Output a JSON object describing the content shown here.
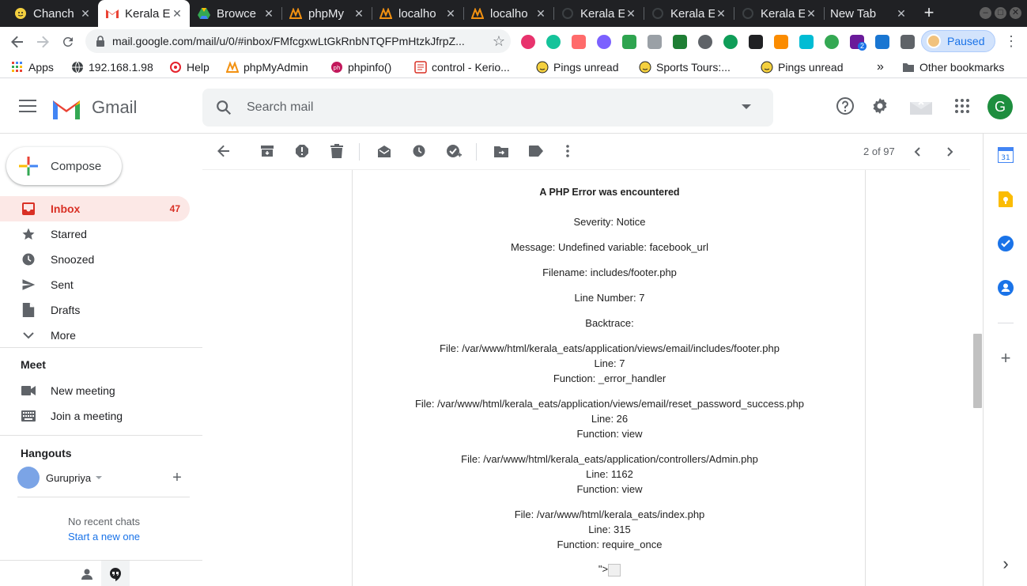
{
  "browser": {
    "tabs": [
      {
        "label": "Chanch",
        "close": "✕",
        "icon": "smiley-icon",
        "color": "#f4d03f"
      },
      {
        "label": "Kerala E",
        "close": "✕",
        "icon": "gmail-icon",
        "color": "#ea4335"
      },
      {
        "label": "Browce",
        "close": "✕",
        "icon": "google-drive-icon",
        "color": "#34a853"
      },
      {
        "label": "phpMy",
        "close": "✕",
        "icon": "phpmyadmin-icon",
        "color": "#f29111"
      },
      {
        "label": "localho",
        "close": "✕",
        "icon": "phpmyadmin-icon",
        "color": "#f29111"
      },
      {
        "label": "localho",
        "close": "✕",
        "icon": "phpmyadmin-icon",
        "color": "#f29111"
      },
      {
        "label": "Kerala E",
        "close": "✕",
        "icon": "loading-icon",
        "color": "#5f6368"
      },
      {
        "label": "Kerala E",
        "close": "✕",
        "icon": "loading-icon",
        "color": "#5f6368"
      },
      {
        "label": "Kerala E",
        "close": "✕",
        "icon": "loading-icon",
        "color": "#5f6368"
      },
      {
        "label": "New Tab",
        "close": "✕",
        "icon": "",
        "color": ""
      }
    ],
    "new_tab": "+",
    "window_controls": {
      "minimize": "–",
      "maximize": "□",
      "close": "✕"
    },
    "url": "mail.google.com/mail/u/0/#inbox/FMfcgxwLtGkRnbNTQFPmHtzkJfrpZ...",
    "star": "☆",
    "profile_status": "Paused",
    "menu": "⋮",
    "extensions": [
      "#e8336d",
      "#15c39a",
      "#ff6b6b",
      "#7b61ff",
      "#2ea44f",
      "#5f6368",
      "#1e7e34",
      "#5f6368",
      "#0f9d58",
      "#202124",
      "#fb8c00",
      "#00bcd4",
      "#34a853",
      "#6a1b9a",
      "#1976d2",
      "#5f6368"
    ],
    "extension_badge": "2",
    "bookmarks": [
      {
        "label": "Apps",
        "icon": "apps-grid-icon"
      },
      {
        "label": "192.168.1.98",
        "icon": "globe-icon"
      },
      {
        "label": "Help",
        "icon": "help-swirl-icon"
      },
      {
        "label": "phpMyAdmin",
        "icon": "phpmyadmin-icon"
      },
      {
        "label": "phpinfo()",
        "icon": "php-icon"
      },
      {
        "label": "control - Kerio...",
        "icon": "kerio-icon"
      },
      {
        "label": "Pings unread",
        "icon": "smiley-icon"
      },
      {
        "label": "Sports Tours:...",
        "icon": "smiley-icon"
      },
      {
        "label": "Pings unread",
        "icon": "smiley-icon"
      }
    ],
    "bookmarks_overflow": "»",
    "other_bookmarks": "Other bookmarks"
  },
  "gmail": {
    "logo_text": "Gmail",
    "search_placeholder": "Search mail",
    "avatar_letter": "G",
    "compose": "Compose",
    "nav": [
      {
        "label": "Inbox",
        "count": "47",
        "icon": "inbox-icon"
      },
      {
        "label": "Starred",
        "count": "",
        "icon": "star-icon"
      },
      {
        "label": "Snoozed",
        "count": "",
        "icon": "clock-icon"
      },
      {
        "label": "Sent",
        "count": "",
        "icon": "send-icon"
      },
      {
        "label": "Drafts",
        "count": "",
        "icon": "draft-icon"
      },
      {
        "label": "More",
        "count": "",
        "icon": "chevron-down-icon"
      }
    ],
    "meet": {
      "title": "Meet",
      "new_meeting": "New meeting",
      "join_meeting": "Join a meeting"
    },
    "hangouts": {
      "title": "Hangouts",
      "user": "Gurupriya",
      "no_chats": "No recent chats",
      "start_new": "Start a new one"
    },
    "pager": "2 of 97"
  },
  "email": {
    "title": "A PHP Error was encountered",
    "severity": "Severity: Notice",
    "message": "Message: Undefined variable: facebook_url",
    "filename": "Filename: includes/footer.php",
    "line_number": "Line Number: 7",
    "backtrace": "Backtrace:",
    "frames": [
      {
        "file": "File: /var/www/html/kerala_eats/application/views/email/includes/footer.php",
        "line": "Line: 7",
        "function": "Function: _error_handler"
      },
      {
        "file": "File: /var/www/html/kerala_eats/application/views/email/reset_password_success.php",
        "line": "Line: 26",
        "function": "Function: view"
      },
      {
        "file": "File: /var/www/html/kerala_eats/application/controllers/Admin.php",
        "line": "Line: 1162",
        "function": "Function: view"
      },
      {
        "file": "File: /var/www/html/kerala_eats/index.php",
        "line": "Line: 315",
        "function": "Function: require_once"
      }
    ],
    "trailing_text": "\">"
  },
  "side_panel": {
    "calendar_day": "31",
    "add": "+",
    "expand": "›"
  },
  "colors": {
    "accent_red": "#d93025",
    "active_nav_bg": "#fce8e6",
    "link_blue": "#1a73e8",
    "dark_chrome": "#202124"
  }
}
